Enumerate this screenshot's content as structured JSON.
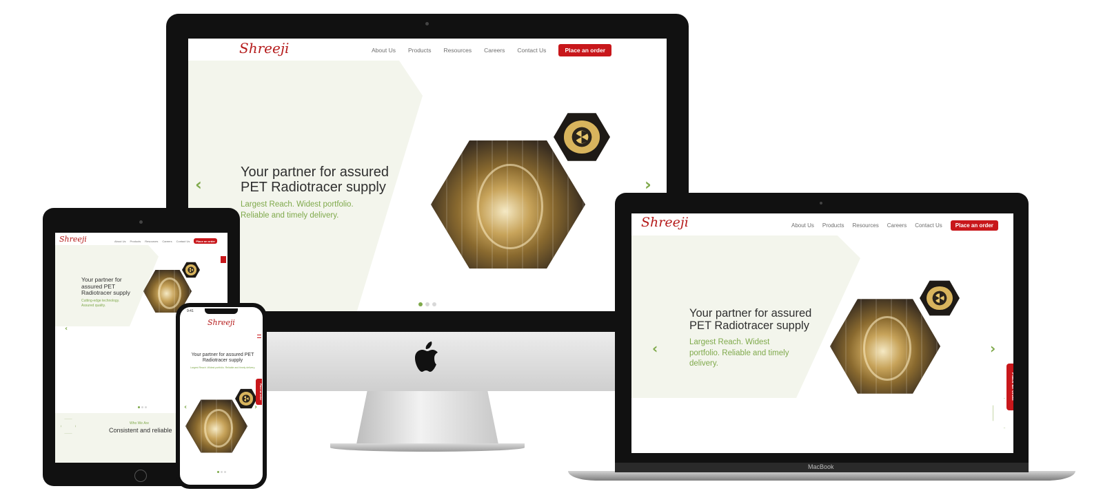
{
  "site": {
    "logo": "Shreeji",
    "nav": [
      "About Us",
      "Products",
      "Resources",
      "Careers",
      "Contact Us"
    ],
    "cta": "Place an order",
    "hero_title": "Your partner for assured PET Radiotracer supply",
    "hero_title_line1": "Your partner for assured",
    "hero_title_line2": "PET Radiotracer supply",
    "hero_sub": "Largest Reach. Widest portfolio. Reliable and timely delivery.",
    "hero_sub_line1": "Largest Reach. Widest portfolio.",
    "hero_sub_line2": "Reliable and timely delivery.",
    "tablet_sub": "Cutting-edge technology. Assured quality.",
    "tablet_title": "Your partner for assured PET Radiotracer supply",
    "section_kicker": "Who We Are",
    "section_title": "Consistent and reliable",
    "side_tab": "Place an order",
    "carousel_pages": 3,
    "carousel_active": 1
  },
  "laptop_label": "MacBook",
  "phone_time": "9:41",
  "colors": {
    "brand_red": "#c8171b",
    "accent_green": "#7fa94b",
    "hero_bg": "#f3f5ec"
  },
  "icons": [
    "apple-logo-icon",
    "radiation-icon",
    "chevron-left-icon",
    "chevron-right-icon",
    "hamburger-menu-icon",
    "camera-icon"
  ]
}
